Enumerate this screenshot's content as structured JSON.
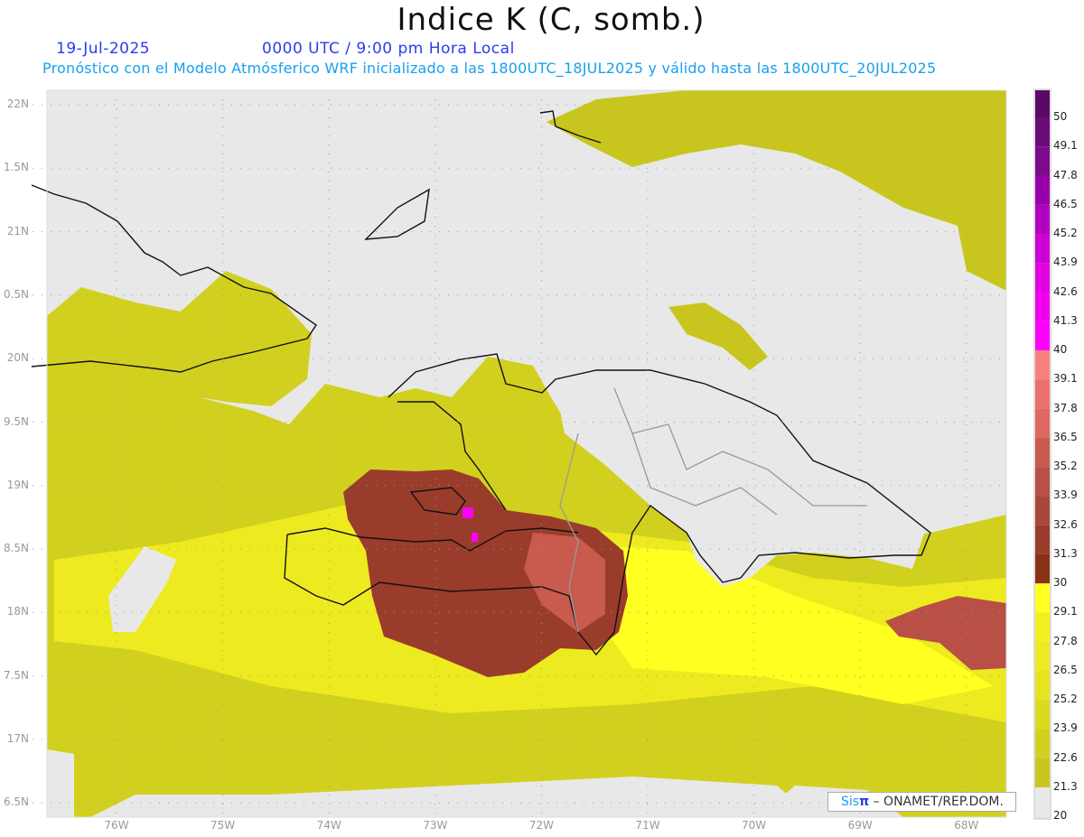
{
  "header": {
    "title": "Indice K (C, somb.)",
    "date": "19-Jul-2025",
    "time": "0000 UTC / 9:00 pm Hora Local",
    "subtitle": "Pronóstico con el Modelo Atmósferico WRF inicializado a las 1800UTC_18JUL2025 y válido hasta las  1800UTC_20JUL2025"
  },
  "axes": {
    "lat_labels": [
      "22N",
      "1.5N",
      "21N",
      "0.5N",
      "20N",
      "9.5N",
      "19N",
      "8.5N",
      "18N",
      "7.5N",
      "17N",
      "6.5N"
    ],
    "lon_labels": [
      "76W",
      "75W",
      "74W",
      "73W",
      "72W",
      "71W",
      "70W",
      "69W",
      "68W"
    ]
  },
  "colorbar": {
    "labels": [
      "50",
      "49.1",
      "47.8",
      "46.5",
      "45.2",
      "43.9",
      "42.6",
      "41.3",
      "40",
      "39.1",
      "37.8",
      "36.5",
      "35.2",
      "33.9",
      "32.6",
      "31.3",
      "30",
      "29.1",
      "27.8",
      "26.5",
      "25.2",
      "23.9",
      "22.6",
      "21.3",
      "20"
    ],
    "colors": [
      "#5a0a64",
      "#6a0c78",
      "#7c0a8c",
      "#9800a8",
      "#b000c0",
      "#cc00d4",
      "#e000e0",
      "#f000ee",
      "#ff00ff",
      "#fa8080",
      "#ec706c",
      "#e06860",
      "#c85a4e",
      "#b85046",
      "#a8483a",
      "#9a3c2c",
      "#8a3218",
      "#ffff20",
      "#f2f01e",
      "#eeea20",
      "#e6e41e",
      "#dcda1e",
      "#d2d01e",
      "#c8c61e",
      "#c0be1e",
      "#e8e8e8"
    ]
  },
  "credit": {
    "sis": "Sis",
    "pi": "π",
    "org": " –  ONAMET/REP.DOM."
  }
}
